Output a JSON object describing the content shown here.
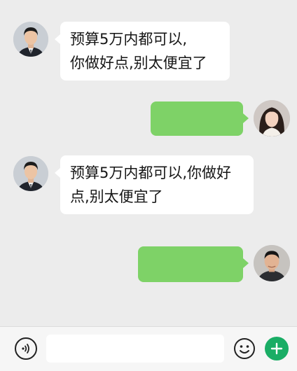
{
  "messages": [
    {
      "direction": "incoming",
      "sender": "contact",
      "text": "预算5万内都可以,\n你做好点,别太便宜了"
    },
    {
      "direction": "outgoing",
      "sender": "me",
      "text": ""
    },
    {
      "direction": "incoming",
      "sender": "contact",
      "text": "预算5万内都可以,你做好\n点,别太便宜了"
    },
    {
      "direction": "outgoing",
      "sender": "me-male",
      "text": ""
    }
  ],
  "input_bar": {
    "voice_icon": "voice-icon",
    "text_value": "",
    "emoji_icon": "smiley-icon",
    "plus_icon": "plus-icon"
  },
  "colors": {
    "chat_bg": "#ececec",
    "incoming_bubble": "#ffffff",
    "outgoing_bubble": "#7ed267",
    "plus_button": "#1aad65"
  }
}
